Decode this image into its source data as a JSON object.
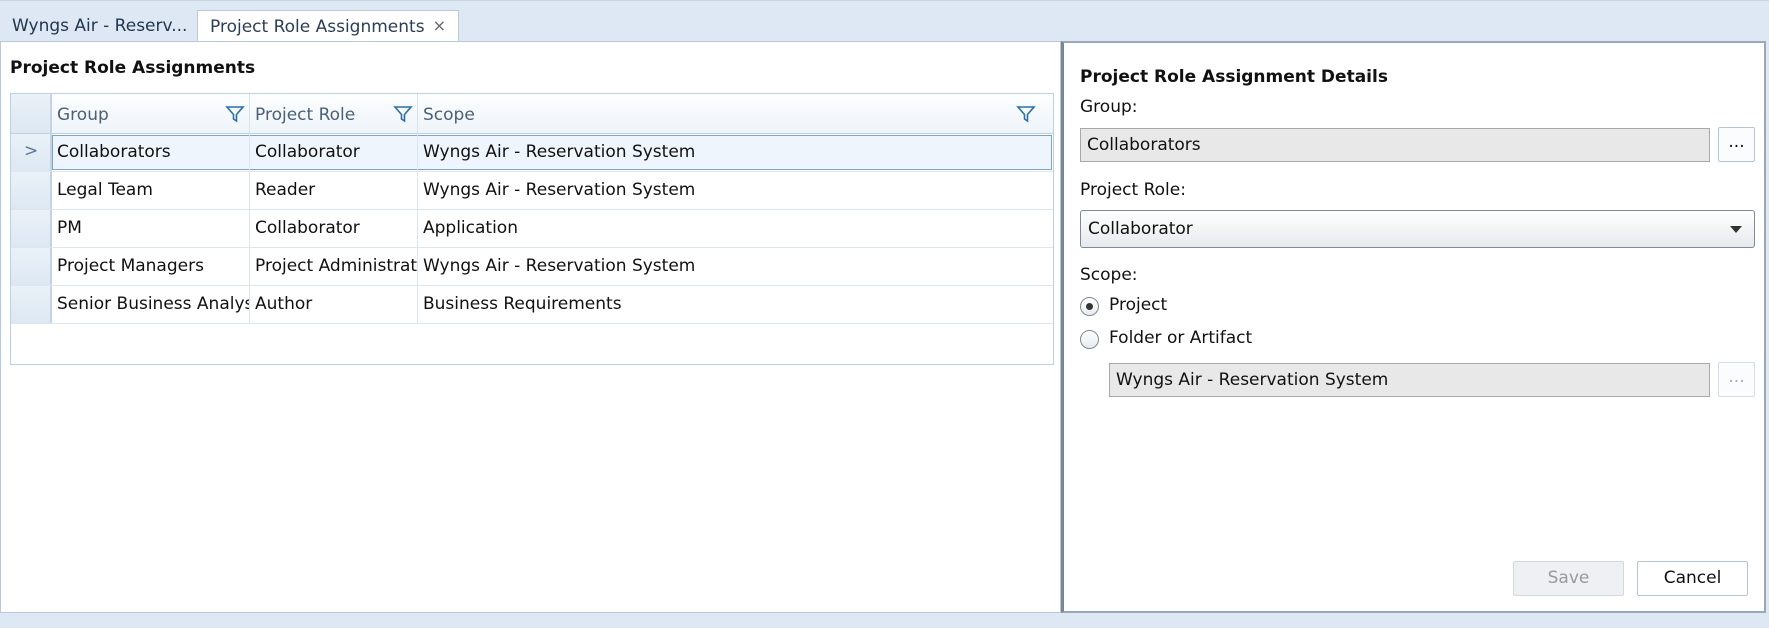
{
  "tabs": [
    {
      "label": "Wyngs Air - Reserv..."
    },
    {
      "label": "Project Role Assignments",
      "close": "×"
    }
  ],
  "left": {
    "title": "Project Role Assignments",
    "columns": [
      "Group",
      "Project Role",
      "Scope"
    ],
    "selected_indicator": ">",
    "rows": [
      {
        "group": "Collaborators",
        "role": "Collaborator",
        "scope": "Wyngs Air - Reservation System"
      },
      {
        "group": "Legal Team",
        "role": "Reader",
        "scope": "Wyngs Air - Reservation System"
      },
      {
        "group": "PM",
        "role": "Collaborator",
        "scope": "Application"
      },
      {
        "group": "Project Managers",
        "role": "Project Administrator",
        "scope": "Wyngs Air - Reservation System"
      },
      {
        "group": "Senior Business Analysists",
        "role": "Author",
        "scope": "Business Requirements"
      }
    ]
  },
  "details": {
    "title": "Project Role Assignment Details",
    "group_label": "Group:",
    "group_value": "Collaborators",
    "browse": "...",
    "role_label": "Project Role:",
    "role_value": "Collaborator",
    "scope_label": "Scope:",
    "scope_options": [
      "Project",
      "Folder or Artifact"
    ],
    "scope_selected": "Project",
    "folder_value": "Wyngs Air - Reservation System",
    "save": "Save",
    "cancel": "Cancel"
  },
  "colors": {
    "accent": "#dde8f4",
    "selection": "#7fa3c8",
    "filter_icon": "#2b6fa8"
  }
}
